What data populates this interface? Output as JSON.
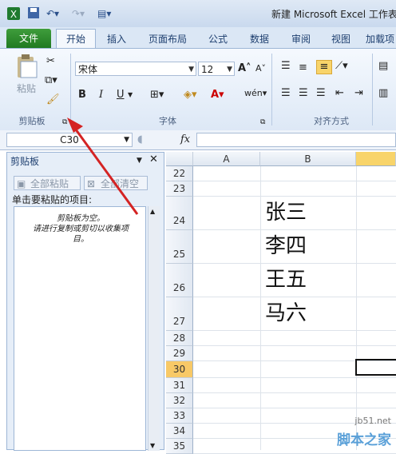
{
  "titlebar": {
    "title": "新建 Microsoft Excel 工作表"
  },
  "tabs": [
    "文件",
    "开始",
    "插入",
    "页面布局",
    "公式",
    "数据",
    "审阅",
    "视图",
    "加载项"
  ],
  "ribbon": {
    "paste_label": "粘贴",
    "clipboard_group": "剪贴板",
    "font_name": "宋体",
    "font_size": "12",
    "font_group": "字体",
    "align_group": "对齐方式",
    "bold": "B",
    "italic": "I",
    "underline": "U"
  },
  "formula": {
    "namebox": "C30",
    "fx": "fx"
  },
  "pane": {
    "title": "剪贴板",
    "paste_all": "全部粘贴",
    "clear_all": "全部清空",
    "hint": "单击要粘贴的项目:",
    "empty_line1": "剪贴板为空。",
    "empty_line2": "请进行复制或剪切以收集项",
    "empty_line3": "目。"
  },
  "grid": {
    "columns": [
      "A",
      "B"
    ],
    "rows": [
      "22",
      "23",
      "24",
      "25",
      "26",
      "27",
      "28",
      "29",
      "30",
      "31",
      "32",
      "33",
      "34",
      "35"
    ],
    "selected_row": "30",
    "names": [
      "张三",
      "李四",
      "王五",
      "马六"
    ]
  },
  "watermark": {
    "line1": "jb51.net",
    "line2": "脚本之家"
  }
}
